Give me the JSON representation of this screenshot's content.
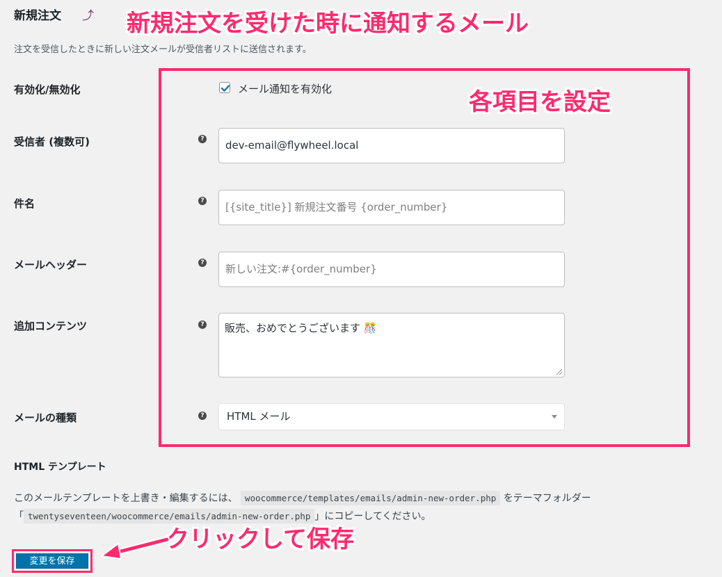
{
  "header": {
    "title": "新規注文",
    "up_icon": "upward-arrow-icon",
    "description": "注文を受信したときに新しい注文メールが受信者リストに送信されます。"
  },
  "annotations": {
    "title_note": "新規注文を受けた時に通知するメール",
    "settings_note": "各項目を設定",
    "save_note": "クリックして保存",
    "accent_color": "#ff2a6d"
  },
  "fields": {
    "enable": {
      "label": "有効化/無効化",
      "checkbox_label": "メール通知を有効化",
      "checked": true
    },
    "recipient": {
      "label": "受信者 (複数可)",
      "value": "dev-email@flywheel.local"
    },
    "subject": {
      "label": "件名",
      "placeholder": "[{site_title}] 新規注文番号 {order_number}"
    },
    "heading": {
      "label": "メールヘッダー",
      "placeholder": "新しい注文:#{order_number}"
    },
    "additional": {
      "label": "追加コンテンツ",
      "value": "販売、おめでとうございます 🎊"
    },
    "email_type": {
      "label": "メールの種類",
      "selected": "HTML メール"
    },
    "help_icon": "help-question-icon"
  },
  "template": {
    "heading": "HTML テンプレート",
    "line1_prefix": "このメールテンプレートを上書き・編集するには、",
    "path1": "woocommerce/templates/emails/admin-new-order.php",
    "line1_suffix": "をテーマフォルダー",
    "line2_prefix": "「",
    "path2": "twentyseventeen/woocommerce/emails/admin-new-order.php",
    "line2_suffix": "」にコピーしてください。"
  },
  "save_button": {
    "label": "変更を保存",
    "color": "#0073aa"
  }
}
